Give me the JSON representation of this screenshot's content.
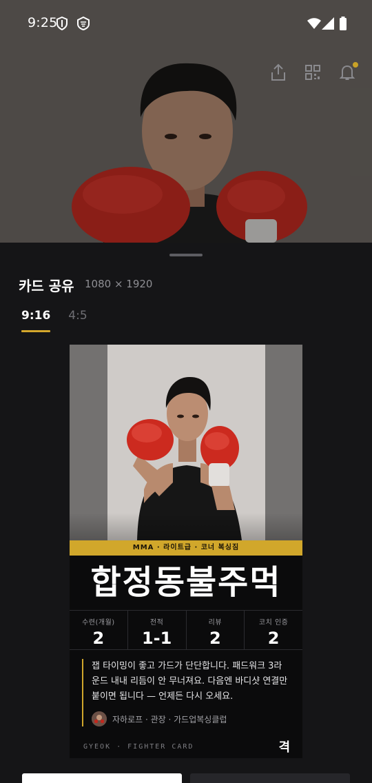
{
  "status_bar": {
    "time": "9:25",
    "icons": [
      "shield-icon",
      "vpn-icon",
      "wifi-icon",
      "signal-icon",
      "battery-icon"
    ]
  },
  "hero": {
    "actions": [
      "share-icon",
      "qr-code-icon",
      "bell-icon"
    ],
    "notification_dot_color": "#c9a227"
  },
  "sheet": {
    "title": "카드 공유",
    "dimensions": "1080 × 1920",
    "tabs": [
      {
        "label": "9:16",
        "active": true
      },
      {
        "label": "4:5",
        "active": false
      }
    ]
  },
  "card": {
    "category_strip": "MMA · 라이트급 · 코너 복싱짐",
    "fighter_name": "합정동불주먹",
    "stats": [
      {
        "label": "수련(개월)",
        "value": "2"
      },
      {
        "label": "전적",
        "value": "1-1"
      },
      {
        "label": "리뷰",
        "value": "2"
      },
      {
        "label": "코치 인증",
        "value": "2"
      }
    ],
    "review": {
      "text": "잽 타이밍이 좋고 가드가 단단합니다. 패드워크 3라운드 내내 리듬이 안 무너져요. 다음엔 바디샷 연결만 붙이면 됩니다 — 언제든 다시 오세요.",
      "author": "자하로프 · 관장 · 가드업복싱클럽"
    },
    "footer": "GYEOK · FIGHTER CARD",
    "logo": "격"
  },
  "colors": {
    "accent": "#d1a72b",
    "sheet_bg": "#151517"
  }
}
